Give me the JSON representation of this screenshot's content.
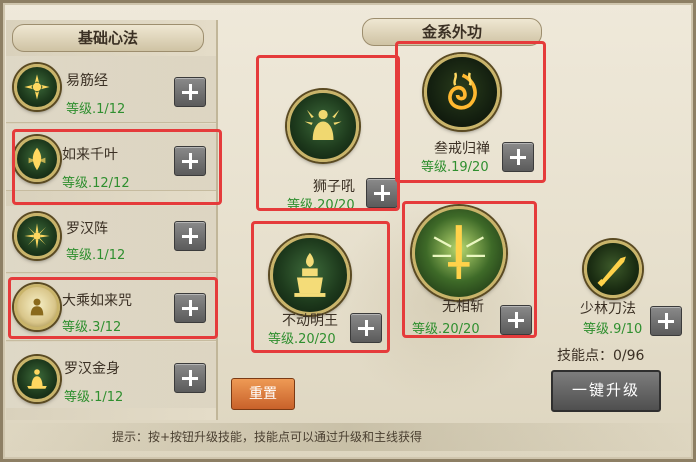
{
  "left_panel": {
    "title": "基础心法",
    "skills": [
      {
        "name": "易筋经",
        "level": "等级.1/12"
      },
      {
        "name": "如来千叶",
        "level": "等级.12/12"
      },
      {
        "name": "罗汉阵",
        "level": "等级.1/12"
      },
      {
        "name": "大乘如来咒",
        "level": "等级.3/12"
      },
      {
        "name": "罗汉金身",
        "level": "等级.1/12"
      }
    ]
  },
  "right_panel": {
    "title": "金系外功",
    "skills": [
      {
        "name": "狮子吼",
        "level": "等级.20/20"
      },
      {
        "name": "叁戒归禅",
        "level": "等级.19/20"
      },
      {
        "name": "不动明王",
        "level": "等级.20/20"
      },
      {
        "name": "无相斩",
        "level": "等级.20/20"
      },
      {
        "name": "少林刀法",
        "level": "等级.9/10"
      }
    ],
    "skill_points": "技能点：0/96"
  },
  "buttons": {
    "reset": "重置",
    "one_key_upgrade": "一键升级"
  },
  "tip": "提示：按+按钮升级技能，技能点可以通过升级和主线获得",
  "colors": {
    "level_green": "#2f8f2f",
    "highlight_red": "#e53b3b",
    "reset_orange": "#d9763a"
  }
}
